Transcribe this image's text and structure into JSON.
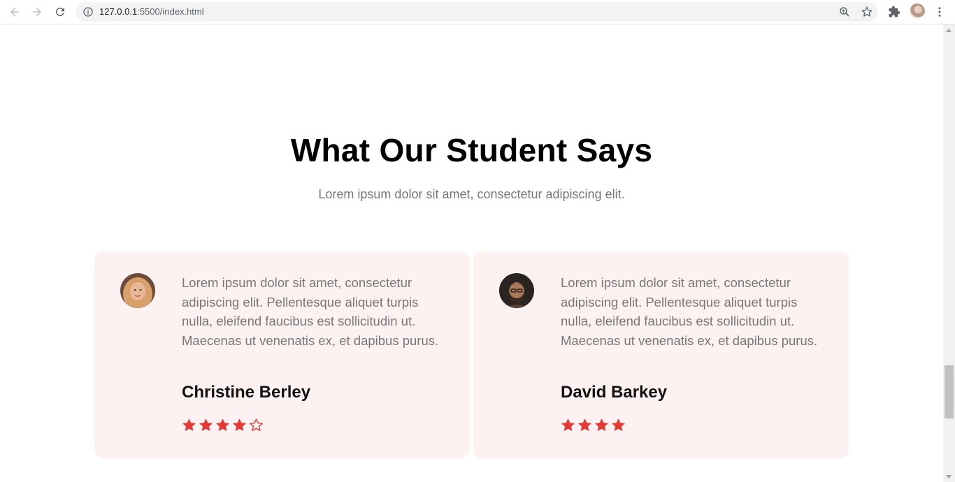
{
  "browser": {
    "url_host": "127.0.0.1",
    "url_rest": ":5500/index.html"
  },
  "section": {
    "title": "What Our Student Says",
    "subtitle": "Lorem ipsum dolor sit amet, consectetur adipiscing elit."
  },
  "testimonials": [
    {
      "text": "Lorem ipsum dolor sit amet, consectetur adipiscing elit. Pellentesque aliquet turpis nulla, eleifend faucibus est sollicitudin ut. Maecenas ut venenatis ex, et dapibus purus.",
      "name": "Christine Berley",
      "rating": 4,
      "rating_max": 5
    },
    {
      "text": "Lorem ipsum dolor sit amet, consectetur adipiscing elit. Pellentesque aliquet turpis nulla, eleifend faucibus est sollicitudin ut. Maecenas ut venenatis ex, et dapibus purus.",
      "name": "David Barkey",
      "rating": 4,
      "rating_max": 4
    }
  ],
  "colors": {
    "card_bg": "#fef1f1",
    "star": "#e53935",
    "text_muted": "#777777"
  },
  "icons": [
    "back-arrow-icon",
    "forward-arrow-icon",
    "reload-icon",
    "info-icon",
    "zoom-icon",
    "star-bookmark-icon",
    "extensions-icon",
    "profile-avatar",
    "menu-icon"
  ]
}
